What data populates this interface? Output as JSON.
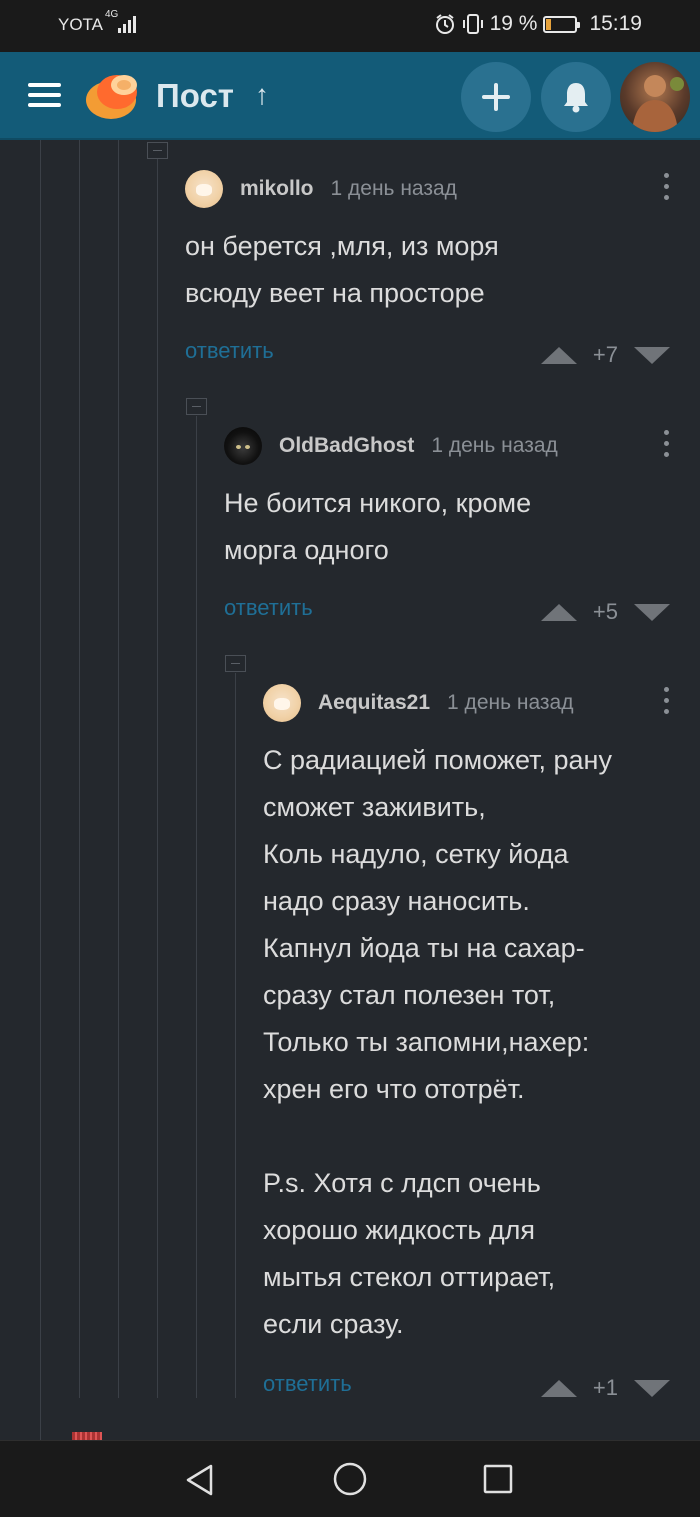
{
  "status_bar": {
    "carrier": "YOTA",
    "network": "4G",
    "battery_percent": "19 %",
    "battery_level": 0.19,
    "time": "15:19"
  },
  "header": {
    "title": "Пост",
    "up_arrow": "↑",
    "add_icon": "plus-icon",
    "notify_icon": "bell-icon",
    "colors": {
      "bar": "#135b78",
      "button": "#2a7190"
    }
  },
  "comments": [
    {
      "author": "mikollo",
      "time": "1 день назад",
      "text": "он берется ,мля, из моря\nвсюду веет на просторе",
      "reply_label": "ответить",
      "score": "+7"
    },
    {
      "author": "OldBadGhost",
      "time": "1 день назад",
      "text": "Не боится никого, кроме\nморга одного",
      "reply_label": "ответить",
      "score": "+5"
    },
    {
      "author": "Aequitas21",
      "time": "1 день назад",
      "text": "С радиацией поможет, рану\nсможет заживить,\nКоль надуло, сетку йода\nнадо сразу наносить.\nКапнул йода ты на сахар-\nсразу стал полезен тот,\nТолько ты запомни,нахер:\nхрен его что ототрёт.\n\nP.s. Хотя с лдсп очень\nхорошо жидкость для\nмытья стекол оттирает,\nесли сразу.",
      "reply_label": "ответить",
      "score": "+1"
    }
  ],
  "nav": {
    "back": "back-icon",
    "home": "home-icon",
    "recents": "recents-icon"
  }
}
